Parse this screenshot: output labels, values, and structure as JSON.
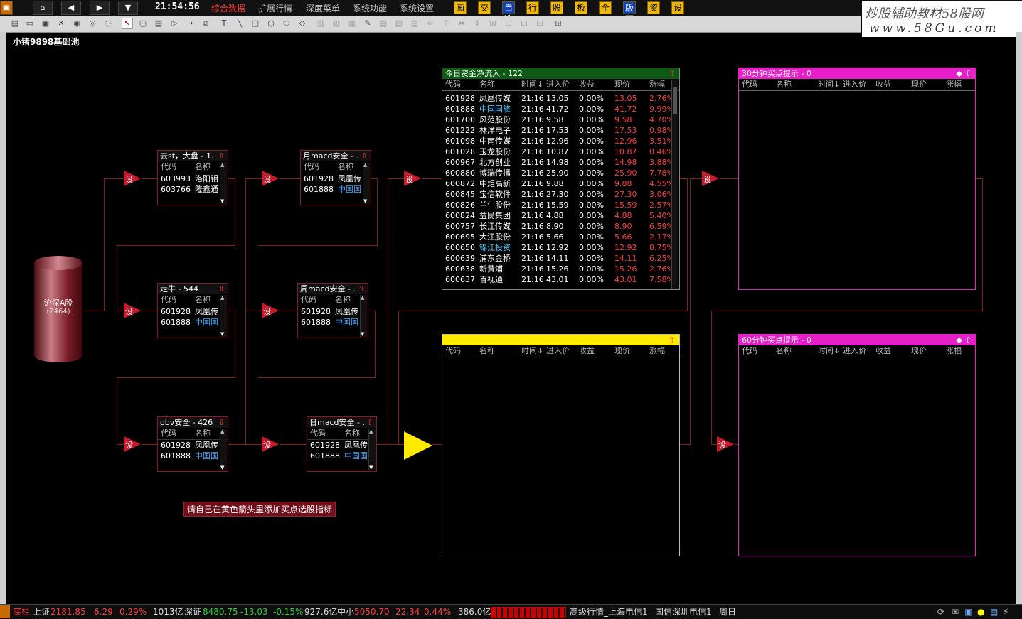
{
  "clock": "21:54:56",
  "menus": [
    "综合数据",
    "扩展行情",
    "深度菜单",
    "系统功能",
    "系统设置"
  ],
  "quick_buttons": [
    "画线",
    "交易",
    "自选",
    "行情",
    "股池",
    "板指",
    "全球",
    "版面",
    "资讯",
    "设置"
  ],
  "watermark": {
    "line1": "炒股辅助教材58股网",
    "line2": "www.58Gu.com"
  },
  "page_title": "小猪9898基础池",
  "source": {
    "label": "沪深A股",
    "count": "(2464)"
  },
  "set_label": "设",
  "columns_small": {
    "code": "代码",
    "name": "名称"
  },
  "columns_big": {
    "code": "代码",
    "name": "名称",
    "time": "时间↓",
    "entry": "进入价",
    "gain": "收益",
    "price": "现价",
    "change": "涨幅"
  },
  "filters": [
    {
      "title": "去st，大盘 - 1.",
      "rows": [
        {
          "code": "603993",
          "name": "洛阳钼"
        },
        {
          "code": "603766",
          "name": "隆鑫通"
        }
      ]
    },
    {
      "title": "走牛 - 544",
      "rows": [
        {
          "code": "601928",
          "name": "凤凰传"
        },
        {
          "code": "601888",
          "name": "中国国"
        }
      ]
    },
    {
      "title": "obv安全 - 426",
      "rows": [
        {
          "code": "601928",
          "name": "凤凰传"
        },
        {
          "code": "601888",
          "name": "中国国"
        }
      ]
    },
    {
      "title": "月macd安全 - .",
      "rows": [
        {
          "code": "601928",
          "name": "凤凰传"
        },
        {
          "code": "601888",
          "name": "中国国"
        }
      ]
    },
    {
      "title": "周macd安全 - .",
      "rows": [
        {
          "code": "601928",
          "name": "凤凰传"
        },
        {
          "code": "601888",
          "name": "中国国"
        }
      ]
    },
    {
      "title": "日macd安全 - .",
      "rows": [
        {
          "code": "601928",
          "name": "凤凰传"
        },
        {
          "code": "601888",
          "name": "中国国"
        }
      ]
    }
  ],
  "inflow": {
    "title": "今日资金净流入 - 122",
    "rows": [
      {
        "code": "601928",
        "name": "凤凰传媒",
        "time": "21:16",
        "entry": "13.05",
        "gain": "0.00%",
        "price": "13.05",
        "change": "2.76%",
        "hl": false
      },
      {
        "code": "601888",
        "name": "中国国旅",
        "time": "21:16",
        "entry": "41.72",
        "gain": "0.00%",
        "price": "41.72",
        "change": "9.99%",
        "hl": true
      },
      {
        "code": "601700",
        "name": "风范股份",
        "time": "21:16",
        "entry": "9.58",
        "gain": "0.00%",
        "price": "9.58",
        "change": "4.70%",
        "hl": false
      },
      {
        "code": "601222",
        "name": "林洋电子",
        "time": "21:16",
        "entry": "17.53",
        "gain": "0.00%",
        "price": "17.53",
        "change": "0.98%",
        "hl": false
      },
      {
        "code": "601098",
        "name": "中南传媒",
        "time": "21:16",
        "entry": "12.96",
        "gain": "0.00%",
        "price": "12.96",
        "change": "3.51%",
        "hl": false
      },
      {
        "code": "601028",
        "name": "玉龙股份",
        "time": "21:16",
        "entry": "10.87",
        "gain": "0.00%",
        "price": "10.87",
        "change": "0.46%",
        "hl": false
      },
      {
        "code": "600967",
        "name": "北方创业",
        "time": "21:16",
        "entry": "14.98",
        "gain": "0.00%",
        "price": "14.98",
        "change": "3.88%",
        "hl": false
      },
      {
        "code": "600880",
        "name": "博瑞传播",
        "time": "21:16",
        "entry": "25.90",
        "gain": "0.00%",
        "price": "25.90",
        "change": "7.78%",
        "hl": false
      },
      {
        "code": "600872",
        "name": "中炬高新",
        "time": "21:16",
        "entry": "9.88",
        "gain": "0.00%",
        "price": "9.88",
        "change": "4.55%",
        "hl": false
      },
      {
        "code": "600845",
        "name": "宝信软件",
        "time": "21:16",
        "entry": "27.30",
        "gain": "0.00%",
        "price": "27.30",
        "change": "3.06%",
        "hl": false
      },
      {
        "code": "600826",
        "name": "兰生股份",
        "time": "21:16",
        "entry": "15.59",
        "gain": "0.00%",
        "price": "15.59",
        "change": "2.57%",
        "hl": false
      },
      {
        "code": "600824",
        "name": "益民集团",
        "time": "21:16",
        "entry": "4.88",
        "gain": "0.00%",
        "price": "4.88",
        "change": "5.40%",
        "hl": false
      },
      {
        "code": "600757",
        "name": "长江传媒",
        "time": "21:16",
        "entry": "8.90",
        "gain": "0.00%",
        "price": "8.90",
        "change": "6.59%",
        "hl": false
      },
      {
        "code": "600695",
        "name": "大江股份",
        "time": "21:16",
        "entry": "5.66",
        "gain": "0.00%",
        "price": "5.66",
        "change": "2.17%",
        "hl": false
      },
      {
        "code": "600650",
        "name": "锦江投资",
        "time": "21:16",
        "entry": "12.92",
        "gain": "0.00%",
        "price": "12.92",
        "change": "8.75%",
        "hl": true
      },
      {
        "code": "600639",
        "name": "浦东金桥",
        "time": "21:16",
        "entry": "14.11",
        "gain": "0.00%",
        "price": "14.11",
        "change": "6.25%",
        "hl": false
      },
      {
        "code": "600638",
        "name": "新黄浦",
        "time": "21:16",
        "entry": "15.26",
        "gain": "0.00%",
        "price": "15.26",
        "change": "2.76%",
        "hl": false
      },
      {
        "code": "600637",
        "name": "百视通",
        "time": "21:16",
        "entry": "43.01",
        "gain": "0.00%",
        "price": "43.01",
        "change": "7.58%",
        "hl": false
      }
    ]
  },
  "panel_30min": {
    "title": "30分钟买点提示 - 0"
  },
  "panel_60min": {
    "title": "60分钟买点提示 - 0"
  },
  "hint": "请自己在黄色箭头里添加买点选股指标",
  "status": {
    "label": "底栏",
    "sh_name": "上证",
    "sh_val": "2181.85",
    "sh_chg": "6.29",
    "sh_pct": "0.29%",
    "sh_amt": "1013亿",
    "sz_name": "深证",
    "sz_val": "8480.75",
    "sz_chg": "-13.03",
    "sz_pct": "-0.15%",
    "sz_amt": "927.6亿",
    "zx_name": "中小",
    "zx_val": "5050.70",
    "zx_chg": "22.34",
    "zx_pct": "0.44%",
    "zx_amt": "386.0亿",
    "srv1": "高级行情_上海电信1",
    "srv2": "国信深圳电信1",
    "day": "周日"
  },
  "colors": {
    "line": "#8a1a22",
    "set": "#c71a2a",
    "arrow": "#ffea00",
    "inflow_head": "#0e5a14",
    "yellow_head": "#ffea00",
    "magenta_head": "#e61fc8"
  }
}
